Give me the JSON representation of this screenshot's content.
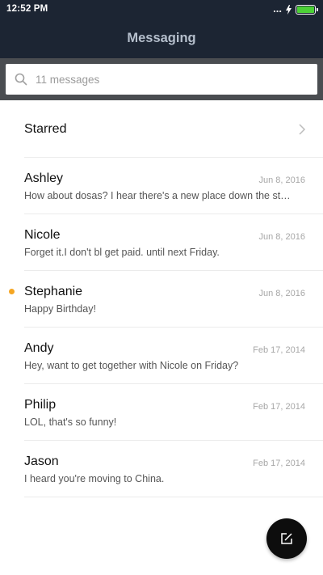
{
  "status_bar": {
    "time": "12:52 PM",
    "signal_text": "...",
    "colors": {
      "background": "#1c2533",
      "battery_fill": "#4cd137"
    }
  },
  "header": {
    "title": "Messaging"
  },
  "search": {
    "placeholder": "11 messages",
    "value": ""
  },
  "starred": {
    "label": "Starred"
  },
  "messages": [
    {
      "sender": "Ashley",
      "date": "Jun 8, 2016",
      "preview": "How about dosas? I hear there's a new place down the st…",
      "unread": false
    },
    {
      "sender": "Nicole",
      "date": "Jun 8, 2016",
      "preview": "Forget it.I don't bl get paid. until next Friday.",
      "unread": false
    },
    {
      "sender": "Stephanie",
      "date": "Jun 8, 2016",
      "preview": "Happy Birthday!",
      "unread": true
    },
    {
      "sender": "Andy",
      "date": "Feb 17, 2014",
      "preview": "Hey, want to get together with Nicole on Friday?",
      "unread": false
    },
    {
      "sender": "Philip",
      "date": "Feb 17, 2014",
      "preview": "LOL, that's so funny!",
      "unread": false
    },
    {
      "sender": "Jason",
      "date": "Feb 17, 2014",
      "preview": "I heard you're moving to China.",
      "unread": false
    }
  ],
  "icons": {
    "search": "search-icon",
    "chevron": "chevron-right-icon",
    "compose": "compose-icon",
    "battery": "battery-icon",
    "charging": "bolt-icon"
  },
  "colors": {
    "unread_dot": "#f5a623",
    "fab": "#0d0d0d",
    "search_frame": "#4a4d51"
  }
}
